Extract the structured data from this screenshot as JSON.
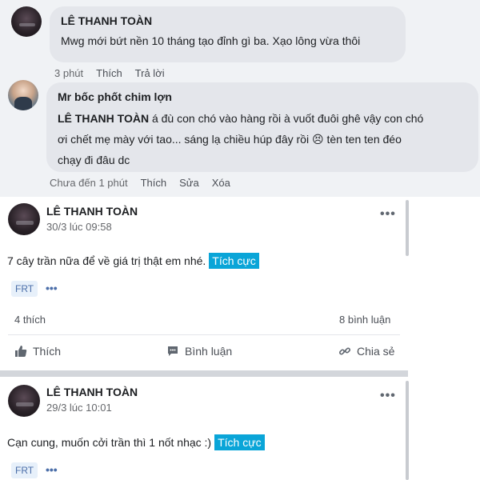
{
  "comments": [
    {
      "author": "LÊ THANH TOÀN",
      "text": "Mwg mới bứt nền 10 tháng tạo đỉnh gì ba. Xạo lông vừa thôi",
      "time": "3 phút",
      "like": "Thích",
      "reply": "Trả lời"
    },
    {
      "author": "Mr bốc phốt chim lợn",
      "mention": "LÊ THANH TOÀN",
      "line1": " á đù con chó vào hàng rồi à vuốt đuôi ghê vậy con chó",
      "line2": "ơi chết mẹ mày với tao... sáng lạ chiều húp đây rồi 😣 tèn ten ten đéo",
      "line3": "chạy đi đâu dc",
      "time": "Chưa đến 1 phút",
      "like": "Thích",
      "edit": "Sửa",
      "delete": "Xóa"
    }
  ],
  "posts": [
    {
      "author": "LÊ THANH TOÀN",
      "time": "30/3 lúc 09:58",
      "more": "•••",
      "text": "7 cây trần nữa để về giá trị thật em nhé.",
      "tag": "Tích cực",
      "chip": "FRT",
      "chip_more": "•••",
      "likes": "4 thích",
      "comments": "8 bình luận",
      "action_like": "Thích",
      "action_comment": "Bình luận",
      "action_share": "Chia sẻ"
    },
    {
      "author": "LÊ THANH TOÀN",
      "time": "29/3 lúc 10:01",
      "more": "•••",
      "text": "Cạn cung, muốn cởi trần thì 1 nốt nhạc :)",
      "tag": "Tích cực",
      "chip": "FRT",
      "chip_more": "•••"
    }
  ],
  "icons": {
    "like": "thumbs-up-icon",
    "comment": "comment-icon",
    "share": "link-icon"
  },
  "colors": {
    "tag": "#0aa5d8",
    "chip_bg": "#e7f0fa",
    "panel_bg": "#f0f2f5",
    "bubble_bg": "#e4e6eb"
  }
}
